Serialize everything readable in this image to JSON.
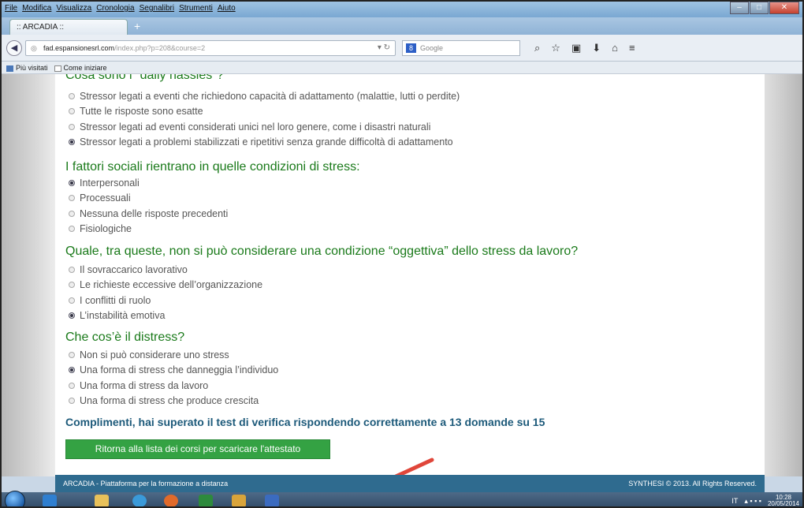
{
  "menu": [
    "File",
    "Modifica",
    "Visualizza",
    "Cronologia",
    "Segnalibri",
    "Strumenti",
    "Aiuto"
  ],
  "tab": {
    "title": ":: ARCADIA ::",
    "new_tab": "+"
  },
  "nav": {
    "url_host": "fad.espansionesrl.com",
    "url_path": "/index.php?p=208&course=2",
    "search_placeholder": "Google",
    "search_engine": "8"
  },
  "bookmarks": [
    "Più visitati",
    "Come iniziare"
  ],
  "questions": [
    {
      "text": "Cosa sono i \"daily hassles\"?",
      "answers": [
        {
          "label": "Stressor legati a eventi che richiedono capacità di adattamento (malattie, lutti o perdite)",
          "selected": false
        },
        {
          "label": "Tutte le risposte sono esatte",
          "selected": false
        },
        {
          "label": "Stressor legati ad eventi considerati unici nel loro genere, come i disastri naturali",
          "selected": false
        },
        {
          "label": "Stressor legati a problemi stabilizzati e ripetitivi senza grande difficoltà di adattamento",
          "selected": true
        }
      ]
    },
    {
      "text": "I fattori sociali rientrano in quelle condizioni di stress:",
      "answers": [
        {
          "label": "Interpersonali",
          "selected": true
        },
        {
          "label": "Processuali",
          "selected": false
        },
        {
          "label": "Nessuna delle risposte precedenti",
          "selected": false
        },
        {
          "label": "Fisiologiche",
          "selected": false
        }
      ]
    },
    {
      "text": "Quale, tra queste, non si può considerare una condizione “oggettiva” dello stress da lavoro?",
      "answers": [
        {
          "label": "Il sovraccarico lavorativo",
          "selected": false
        },
        {
          "label": "Le richieste eccessive dell’organizzazione",
          "selected": false
        },
        {
          "label": "I conflitti di ruolo",
          "selected": false
        },
        {
          "label": "L’instabilità emotiva",
          "selected": true
        }
      ]
    },
    {
      "text": "Che cos’è il distress?",
      "answers": [
        {
          "label": "Non si può considerare uno stress",
          "selected": false
        },
        {
          "label": "Una forma di stress che danneggia l’individuo",
          "selected": true
        },
        {
          "label": "Una forma di stress da lavoro",
          "selected": false
        },
        {
          "label": "Una forma di stress che produce crescita",
          "selected": false
        }
      ]
    }
  ],
  "result_text": "Complimenti, hai superato il test di verifica rispondendo correttamente a 13 domande su 15",
  "return_button": "Ritorna alla lista dei corsi per scaricare l'attestato",
  "footer": {
    "left": "ARCADIA - Piattaforma per la formazione a distanza",
    "right": "SYNTHESI © 2013. All Rights Reserved."
  },
  "taskbar": {
    "lang": "IT",
    "time": "10:28",
    "date": "20/05/2014"
  },
  "colors": {
    "question": "#1a7a1a",
    "result": "#1d5a7a",
    "button": "#34a243",
    "footer": "#2f6b8f",
    "arrow": "#e0463a"
  }
}
